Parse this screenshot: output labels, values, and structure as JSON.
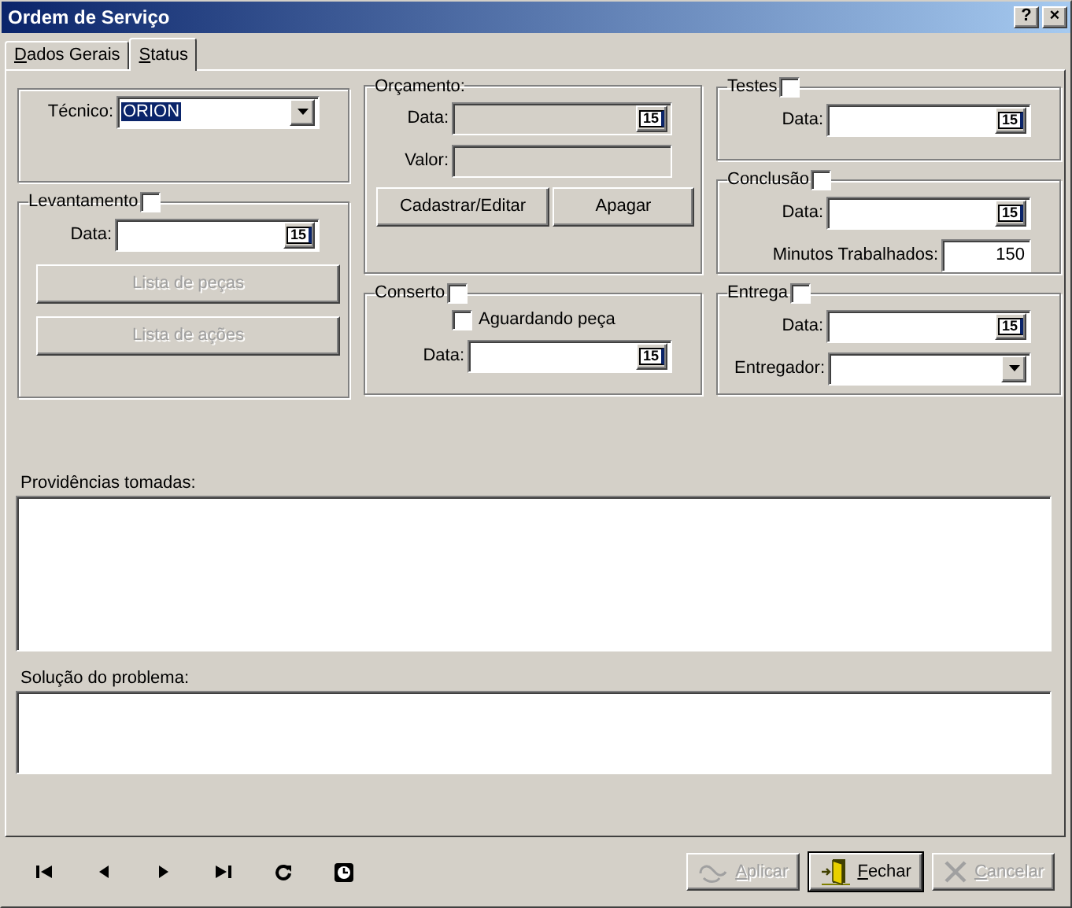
{
  "window": {
    "title": "Ordem de Serviço",
    "buttons": [
      "?",
      "×"
    ]
  },
  "tabs": [
    {
      "label": "Dados Gerais",
      "selected": false
    },
    {
      "label": "Status",
      "selected": true
    }
  ],
  "columns": [
    [
      {
        "fields": [
          {
            "kind": "select",
            "label": "Técnico:",
            "value": "ORION",
            "selected": true
          }
        ]
      },
      {
        "legend": "Levantamento",
        "checked": false,
        "fields": [
          {
            "kind": "date",
            "label": "Data:",
            "calendar": "15",
            "disabled": false
          },
          {
            "kind": "button",
            "label": "Lista de peças",
            "disabled": true
          },
          {
            "kind": "button",
            "label": "Lista de ações",
            "disabled": true
          }
        ]
      }
    ],
    [
      {
        "legend": "Orçamento:",
        "fields": [
          {
            "kind": "date",
            "label": "Data:",
            "calendar": "15",
            "disabled": true
          },
          {
            "kind": "text",
            "label": "Valor:",
            "disabled": true
          },
          {
            "kind": "buttons",
            "buttons": [
              {
                "label": "Cadastrar/Editar",
                "disabled": false
              },
              {
                "label": "Apagar",
                "disabled": false
              }
            ]
          }
        ]
      },
      {
        "legend": "Conserto",
        "checked": false,
        "fields": [
          {
            "kind": "checkbox",
            "label": "Aguardando peça",
            "checked": false
          },
          {
            "kind": "date",
            "label": "Data:",
            "calendar": "15",
            "disabled": false
          }
        ]
      }
    ],
    [
      {
        "legend": "Testes",
        "checked": false,
        "fields": [
          {
            "kind": "date",
            "label": "Data:",
            "calendar": "15",
            "disabled": false
          }
        ]
      },
      {
        "legend": "Conclusão",
        "checked": false,
        "fields": [
          {
            "kind": "date",
            "label": "Data:",
            "calendar": "15",
            "disabled": false
          },
          {
            "kind": "number",
            "label": "Minutos Trabalhados:",
            "value": "150"
          }
        ]
      },
      {
        "legend": "Entrega",
        "checked": false,
        "fields": [
          {
            "kind": "date",
            "label": "Data:",
            "calendar": "15",
            "disabled": false
          },
          {
            "kind": "select",
            "label": "Entregador:"
          }
        ]
      }
    ]
  ],
  "notes": [
    {
      "label": "Providências tomadas:"
    },
    {
      "label": "Solução do problema:"
    }
  ],
  "navigation": [
    {
      "kind": "first"
    },
    {
      "kind": "previous"
    },
    {
      "kind": "next"
    },
    {
      "kind": "last"
    },
    {
      "kind": "refresh"
    },
    {
      "kind": "clock"
    }
  ],
  "actions": [
    {
      "kind": "apply",
      "label": "Aplicar",
      "disabled": true
    },
    {
      "kind": "close",
      "label": "Fechar",
      "disabled": false
    },
    {
      "kind": "cancel",
      "label": "Cancelar",
      "disabled": true
    }
  ]
}
